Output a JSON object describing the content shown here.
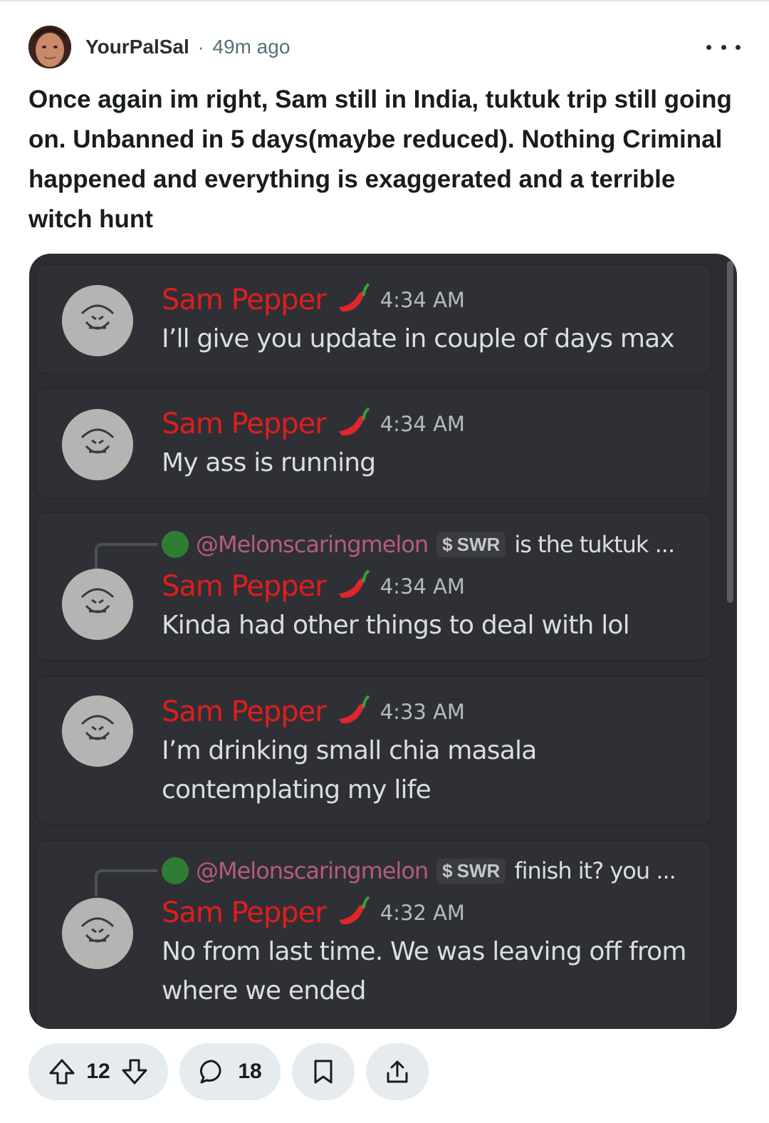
{
  "post": {
    "author": "YourPalSal",
    "separator": "·",
    "time": "49m ago",
    "title": "Once again im right, Sam still in India, tuktuk trip still going on. Unbanned in 5 days(maybe reduced). Nothing Criminal happened and everything is exaggerated and a terrible witch hunt"
  },
  "discord": {
    "messages": [
      {
        "sender": "Sam Pepper",
        "time": "4:34 AM",
        "text": "I’ll give you update in couple of days max"
      },
      {
        "sender": "Sam Pepper",
        "time": "4:34 AM",
        "text": "My ass is running"
      },
      {
        "reply": {
          "mention": "@Melonscaringmelon",
          "tag": "SWR",
          "snippet": "is the tuktuk ..."
        },
        "sender": "Sam Pepper",
        "time": "4:34 AM",
        "text": "Kinda had other things to deal with lol"
      },
      {
        "sender": "Sam Pepper",
        "time": "4:33 AM",
        "text": "I’m drinking small chia masala contemplating my life"
      },
      {
        "reply": {
          "mention": "@Melonscaringmelon",
          "tag": "SWR",
          "snippet": "finish it? you ..."
        },
        "sender": "Sam Pepper",
        "time": "4:32 AM",
        "text": "No from last time. We was leaving off from where we ended"
      }
    ],
    "icons": {
      "sender_badge": "chili-pepper-icon",
      "tag_icon": "dollar-icon"
    },
    "colors": {
      "background": "#2b2d31",
      "sender": "#e01d1d",
      "mention": "#b55c7a"
    }
  },
  "actions": {
    "upvotes": "12",
    "comments": "18",
    "icons": [
      "upvote-icon",
      "downvote-icon",
      "comment-icon",
      "save-icon",
      "share-icon"
    ]
  }
}
